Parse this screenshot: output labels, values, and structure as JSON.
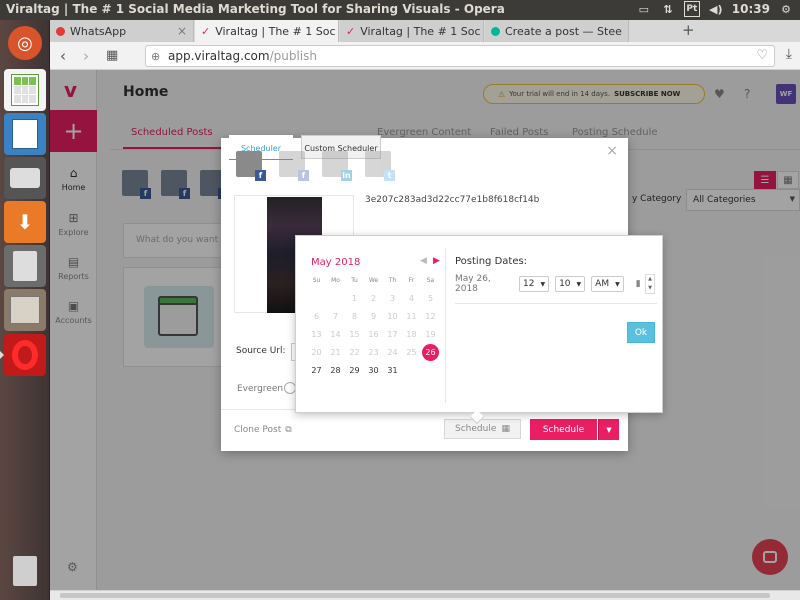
{
  "window_title": "Viraltag | The # 1 Social Media Marketing Tool for Sharing Visuals - Opera",
  "tray": {
    "keyboard": "Pt",
    "time": "10:39"
  },
  "tabs": [
    {
      "label": "WhatsApp",
      "color": "#e53935"
    },
    {
      "label": "Viraltag | The # 1 Soc",
      "color": "#e91e63"
    },
    {
      "label": "Viraltag | The # 1 Soc",
      "color": "#e91e63"
    },
    {
      "label": "Create a post — Stee",
      "color": "#00b894"
    }
  ],
  "address": {
    "host": "app.viraltag.com",
    "path": "/publish"
  },
  "sidenav": {
    "logo": "v",
    "home": "Home",
    "explore": "Explore",
    "reports": "Reports",
    "accounts": "Accounts"
  },
  "header": {
    "title": "Home",
    "trial_text": "Your trial will end in 14 days.",
    "trial_cta": "SUBSCRIBE NOW",
    "avatar": "WF"
  },
  "page_tabs": [
    "Scheduled Posts",
    "Evergreen Content",
    "Failed Posts",
    "Posting Schedule"
  ],
  "composer_placeholder": "What do you want to",
  "category": {
    "label": "y Category",
    "selected": "All Categories"
  },
  "modal": {
    "tab_scheduler": "Scheduler",
    "tab_custom": "Custom Scheduler",
    "hash": "3e207c283ad3d22cc77e1b8f618cf14b",
    "source_label": "Source Url:",
    "evergreen_label": "Evergreen",
    "clone_label": "Clone Post",
    "schedule_field": "Schedule",
    "schedule_button": "Schedule"
  },
  "picker": {
    "month": "May 2018",
    "weekdays": [
      "Su",
      "Mo",
      "Tu",
      "We",
      "Th",
      "Fr",
      "Sa"
    ],
    "days": [
      [
        " ",
        " ",
        "1",
        "2",
        "3",
        "4",
        "5"
      ],
      [
        "6",
        "7",
        "8",
        "9",
        "10",
        "11",
        "12"
      ],
      [
        "13",
        "14",
        "15",
        "16",
        "17",
        "18",
        "19"
      ],
      [
        "20",
        "21",
        "22",
        "23",
        "24",
        "25",
        "26"
      ],
      [
        "27",
        "28",
        "29",
        "30",
        "31",
        " ",
        " "
      ]
    ],
    "selected_day": "26",
    "first_enabled": "26",
    "posting_label": "Posting Dates:",
    "date": "May 26, 2018",
    "hour": "12",
    "minute": "10",
    "ampm": "AM",
    "ok": "Ok"
  },
  "colors": {
    "brand": "#e91e63",
    "ok": "#5bc0de",
    "facebook": "#3b5998",
    "twitter": "#55acee",
    "linkedin": "#0077b5"
  }
}
